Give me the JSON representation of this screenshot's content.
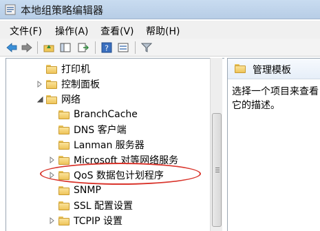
{
  "window": {
    "title": "本地组策略编辑器"
  },
  "menubar": {
    "items": [
      "文件(F)",
      "操作(A)",
      "查看(V)",
      "帮助(H)"
    ]
  },
  "toolbar": {
    "icons": [
      "back-arrow-icon",
      "forward-arrow-icon",
      "up-folder-icon",
      "show-hide-tree-icon",
      "export-list-icon",
      "help-icon",
      "properties-icon",
      "filter-icon"
    ]
  },
  "tree": {
    "items": [
      {
        "label": "打印机",
        "expandable": false
      },
      {
        "label": "控制面板",
        "expandable": true
      },
      {
        "label": "网络",
        "expandable": true,
        "expanded": true
      },
      {
        "label": "BranchCache",
        "expandable": false
      },
      {
        "label": "DNS 客户端",
        "expandable": false
      },
      {
        "label": "Lanman 服务器",
        "expandable": false
      },
      {
        "label": "Microsoft 对等网络服务",
        "expandable": true
      },
      {
        "label": "QoS 数据包计划程序",
        "expandable": true,
        "highlighted": true
      },
      {
        "label": "SNMP",
        "expandable": false
      },
      {
        "label": "SSL 配置设置",
        "expandable": false
      },
      {
        "label": "TCPIP 设置",
        "expandable": true
      }
    ]
  },
  "detail": {
    "header": "管理模板",
    "description": "选择一个项目来查看它的描述。"
  },
  "colors": {
    "highlight_ellipse": "#d9342b",
    "folder": "#eec45a",
    "titlebar": "#c9dcf0"
  }
}
